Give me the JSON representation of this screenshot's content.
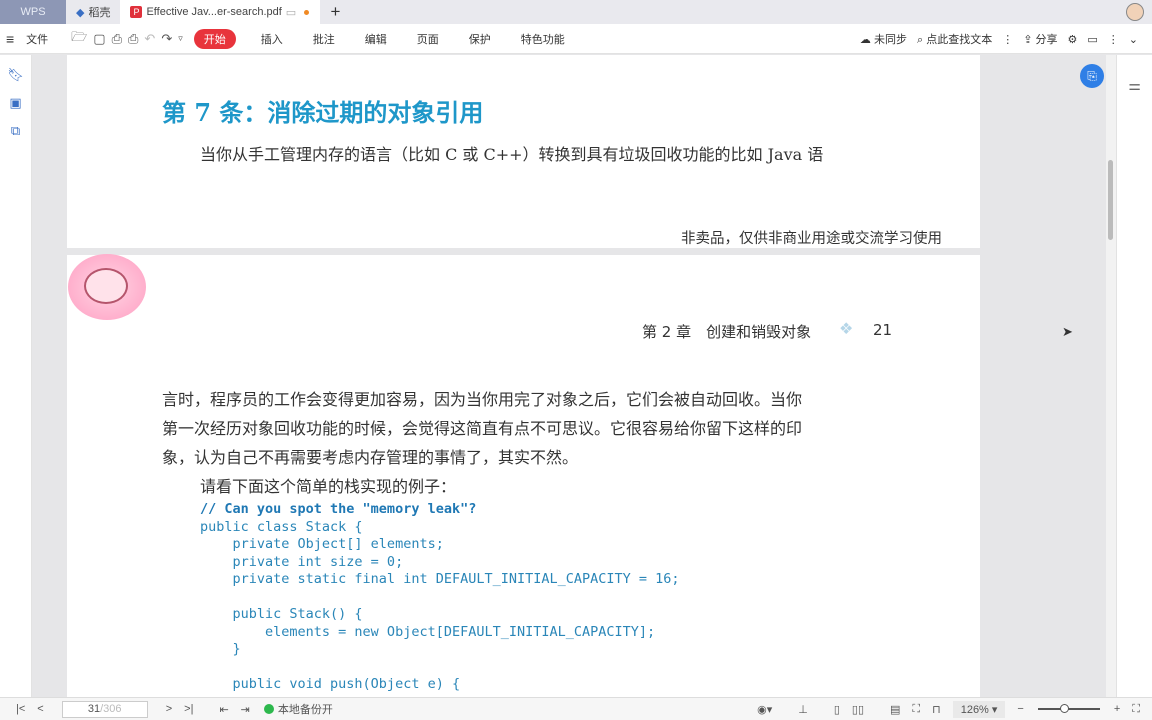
{
  "tabs": {
    "wps": "WPS",
    "daoke": "稻壳",
    "doc": "Effective Jav...er-search.pdf",
    "new": "+"
  },
  "toolbar": {
    "file": "文件",
    "start": "开始",
    "menus": [
      "插入",
      "批注",
      "编辑",
      "页面",
      "保护",
      "特色功能"
    ],
    "sync": "未同步",
    "search": "点此查找文本",
    "share": "分享"
  },
  "page1": {
    "title": "第 7 条：消除过期的对象引用",
    "line": "当你从手工管理内存的语言（比如 C 或 C++）转换到具有垃圾回收功能的比如 Java 语",
    "footer": "非卖品，仅供非商业用途或交流学习使用"
  },
  "page2": {
    "header_chapter": "第 2 章　创建和销毁对象",
    "page_number": "21",
    "para": [
      "言时，程序员的工作会变得更加容易，因为当你用完了对象之后，它们会被自动回收。当你",
      "第一次经历对象回收功能的时候，会觉得这简直有点不可思议。它很容易给你留下这样的印",
      "象，认为自己不再需要考虑内存管理的事情了，其实不然。"
    ],
    "intro": "请看下面这个简单的栈实现的例子：",
    "code_comment": "// Can you spot the \"memory leak\"?",
    "code": [
      "public class Stack {",
      "    private Object[] elements;",
      "    private int size = 0;",
      "    private static final int DEFAULT_INITIAL_CAPACITY = 16;",
      "",
      "    public Stack() {",
      "        elements = new Object[DEFAULT_INITIAL_CAPACITY];",
      "    }",
      "",
      "    public void push(Object e) {"
    ]
  },
  "status": {
    "current_page": "31",
    "total_pages": "/306",
    "backup": "本地备份开",
    "zoom": "126%"
  },
  "colors": {
    "accent": "#e8343c",
    "title": "#1e97c9",
    "code": "#2a86b8"
  }
}
